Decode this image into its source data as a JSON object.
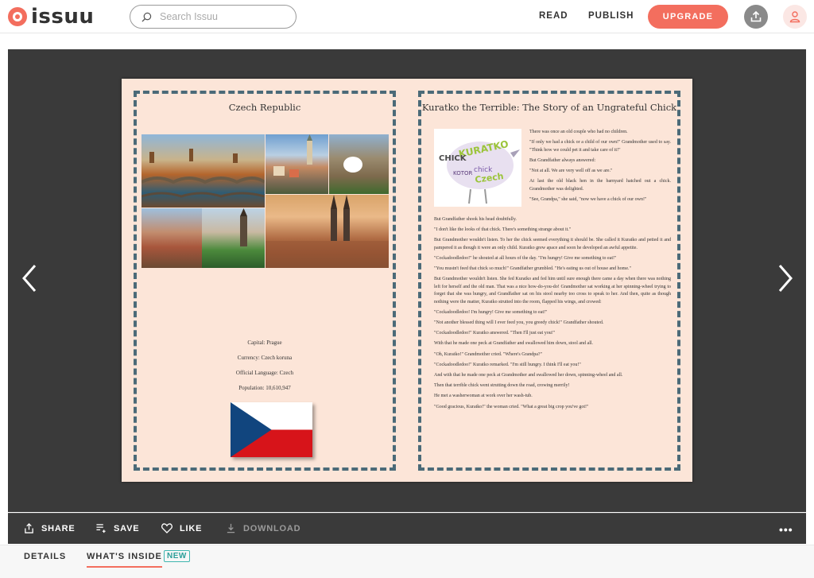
{
  "brand": {
    "name": "issuu"
  },
  "search": {
    "placeholder": "Search Issuu"
  },
  "nav": {
    "read": "READ",
    "publish": "PUBLISH",
    "upgrade": "UPGRADE"
  },
  "publication": {
    "left_page": {
      "title": "Czech Republic",
      "facts": [
        "Capital: Prague",
        "Currency: Czech koruna",
        "Official Language: Czech",
        "Population: 10,610,947"
      ],
      "flag_colors": {
        "white": "#ffffff",
        "red": "#d7141a",
        "blue": "#11457e"
      }
    },
    "right_page": {
      "title": "Kuratko the Terrible: The Story of an Ungrateful Chick",
      "wordcloud_words": [
        "KURATKO",
        "CHICK",
        "chick",
        "Czech",
        "KOTOR"
      ],
      "paragraphs": [
        "There was once an old couple who had no children.",
        "\"If only we had a chick or a child of our own!\" Grandmother used to say. \"Think how we could pet it and take care of it!\"",
        "But Grandfather always answered:",
        "\"Not at all. We are very well off as we are.\"",
        "At last the old black hen in the barnyard hatched out a chick. Grandmother was delighted.",
        "\"See, Grandpa,\" she said, \"now we have a chick of our own!\"",
        "But Grandfather shook his head doubtfully.",
        "\"I don't like the looks of that chick. There's something strange about it.\"",
        "But Grandmother wouldn't listen. To her the chick seemed everything it should be. She called it Kuratko and petted it and pampered it as though it were an only child. Kuratko grew apace and soon he developed an awful appetite.",
        "\"Cockadoodledoo!\" he shouted at all hours of the day. \"I'm hungry! Give me something to eat!\"",
        "\"You mustn't feed that chick so much!\" Grandfather grumbled. \"He's eating us out of house and home.\"",
        "But Grandmother wouldn't listen. She fed Kuratko and fed him until sure enough there came a day when there was nothing left for herself and the old man. That was a nice how-do-you-do! Grandmother sat working at her spinning-wheel trying to forget that she was hungry, and Grandfather sat on his stool nearby too cross to speak to her. And then, quite as though nothing were the matter, Kuratko strutted into the room, flapped his wings, and crowed:",
        "\"Cockadoodledoo! I'm hungry! Give me something to eat!\"",
        "\"Not another blessed thing will I ever feed you, you greedy chick!\" Grandfather shouted.",
        "\"Cockadoodledoo!\" Kuratko answered. \"Then I'll just eat you!\"",
        "With that he made one peck at Grandfather and swallowed him down, stool and all.",
        "\"Oh, Kuratko!\" Grandmother cried. \"Where's Grandpa?\"",
        "\"Cockadoodledoo!\" Kuratko remarked. \"I'm still hungry. I think I'll eat you!\"",
        "And with that he made one peck at Grandmother and swallowed her down, spinning-wheel and all.",
        "Then that terrible chick went strutting down the road, crowing merrily!",
        "He met a washerwoman at work over her wash-tub.",
        "\"Good gracious, Kuratko!\" the woman cried. \"What a great big crop you've got!\""
      ]
    }
  },
  "actions": {
    "share": "SHARE",
    "save": "SAVE",
    "like": "LIKE",
    "download": "DOWNLOAD",
    "more": "•••"
  },
  "tabs": {
    "details": "DETAILS",
    "whats_inside": "WHAT'S INSIDE",
    "badge": "NEW"
  },
  "colors": {
    "brand": "#f36e5e",
    "viewer_bg": "#3a3a3a",
    "page_bg": "#fce5d8",
    "frame": "#4b6a78",
    "badge": "#3fb6b0"
  }
}
